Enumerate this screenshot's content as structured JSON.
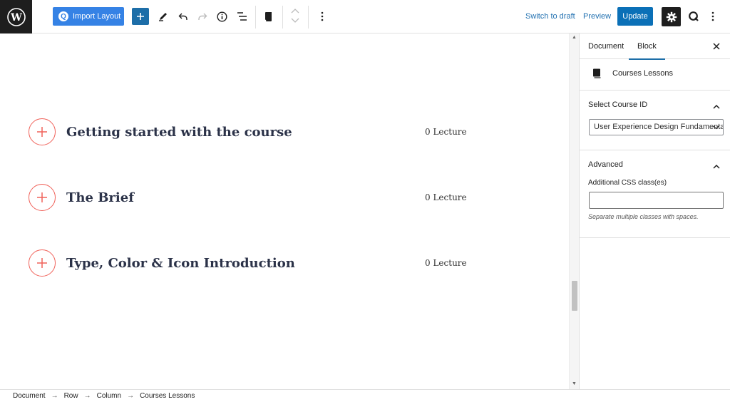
{
  "toolbar": {
    "import_label": "Import Layout",
    "switch_draft": "Switch to draft",
    "preview": "Preview",
    "update": "Update"
  },
  "lessons": [
    {
      "title": "Getting started with the course",
      "count": "0 Lecture"
    },
    {
      "title": "The Brief",
      "count": "0 Lecture"
    },
    {
      "title": "Type, Color & Icon Introduction",
      "count": "0 Lecture"
    }
  ],
  "sidebar": {
    "tabs": [
      "Document",
      "Block"
    ],
    "active_tab": "Block",
    "block_name": "Courses Lessons",
    "course_panel": {
      "title": "Select Course ID",
      "selected": "User Experience Design Fundamentals"
    },
    "advanced_panel": {
      "title": "Advanced",
      "css_label": "Additional CSS class(es)",
      "css_value": "",
      "help": "Separate multiple classes with spaces."
    }
  },
  "breadcrumb": [
    "Document",
    "Row",
    "Column",
    "Courses Lessons"
  ],
  "colors": {
    "accent": "#3582e5",
    "update": "#0b70b7",
    "lesson_icon": "#f0625a",
    "lesson_title": "#2b3248"
  }
}
